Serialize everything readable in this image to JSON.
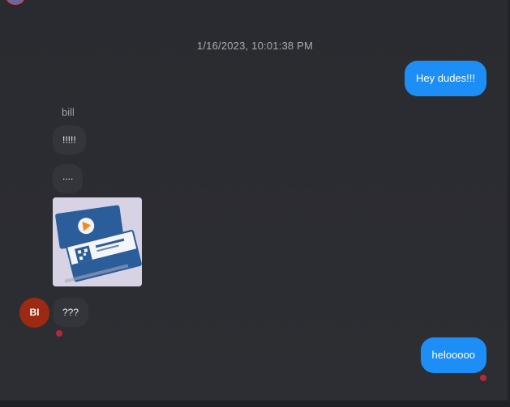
{
  "conversation": {
    "timestamp": "1/16/2023, 10:01:38 PM",
    "messages": [
      {
        "direction": "outgoing",
        "text": "Hey dudes!!!"
      },
      {
        "direction": "incoming",
        "sender": "bill",
        "text": "!!!!!"
      },
      {
        "direction": "incoming",
        "sender": "bill",
        "text": "...."
      },
      {
        "direction": "incoming",
        "sender": "bill",
        "type": "image",
        "image_icon": "business-cards-photo"
      },
      {
        "direction": "incoming",
        "sender": "bill",
        "text": "???"
      },
      {
        "direction": "outgoing",
        "text": "helooooo"
      }
    ],
    "incoming_sender_name": "bill",
    "incoming_avatar_initials": "BI"
  },
  "colors": {
    "outgoing_bubble": "#1c8ef5",
    "incoming_bubble": "#34353b",
    "avatar_bg": "#9c2a12",
    "unread_dot": "#b3283b",
    "background": "#2b2c31"
  }
}
